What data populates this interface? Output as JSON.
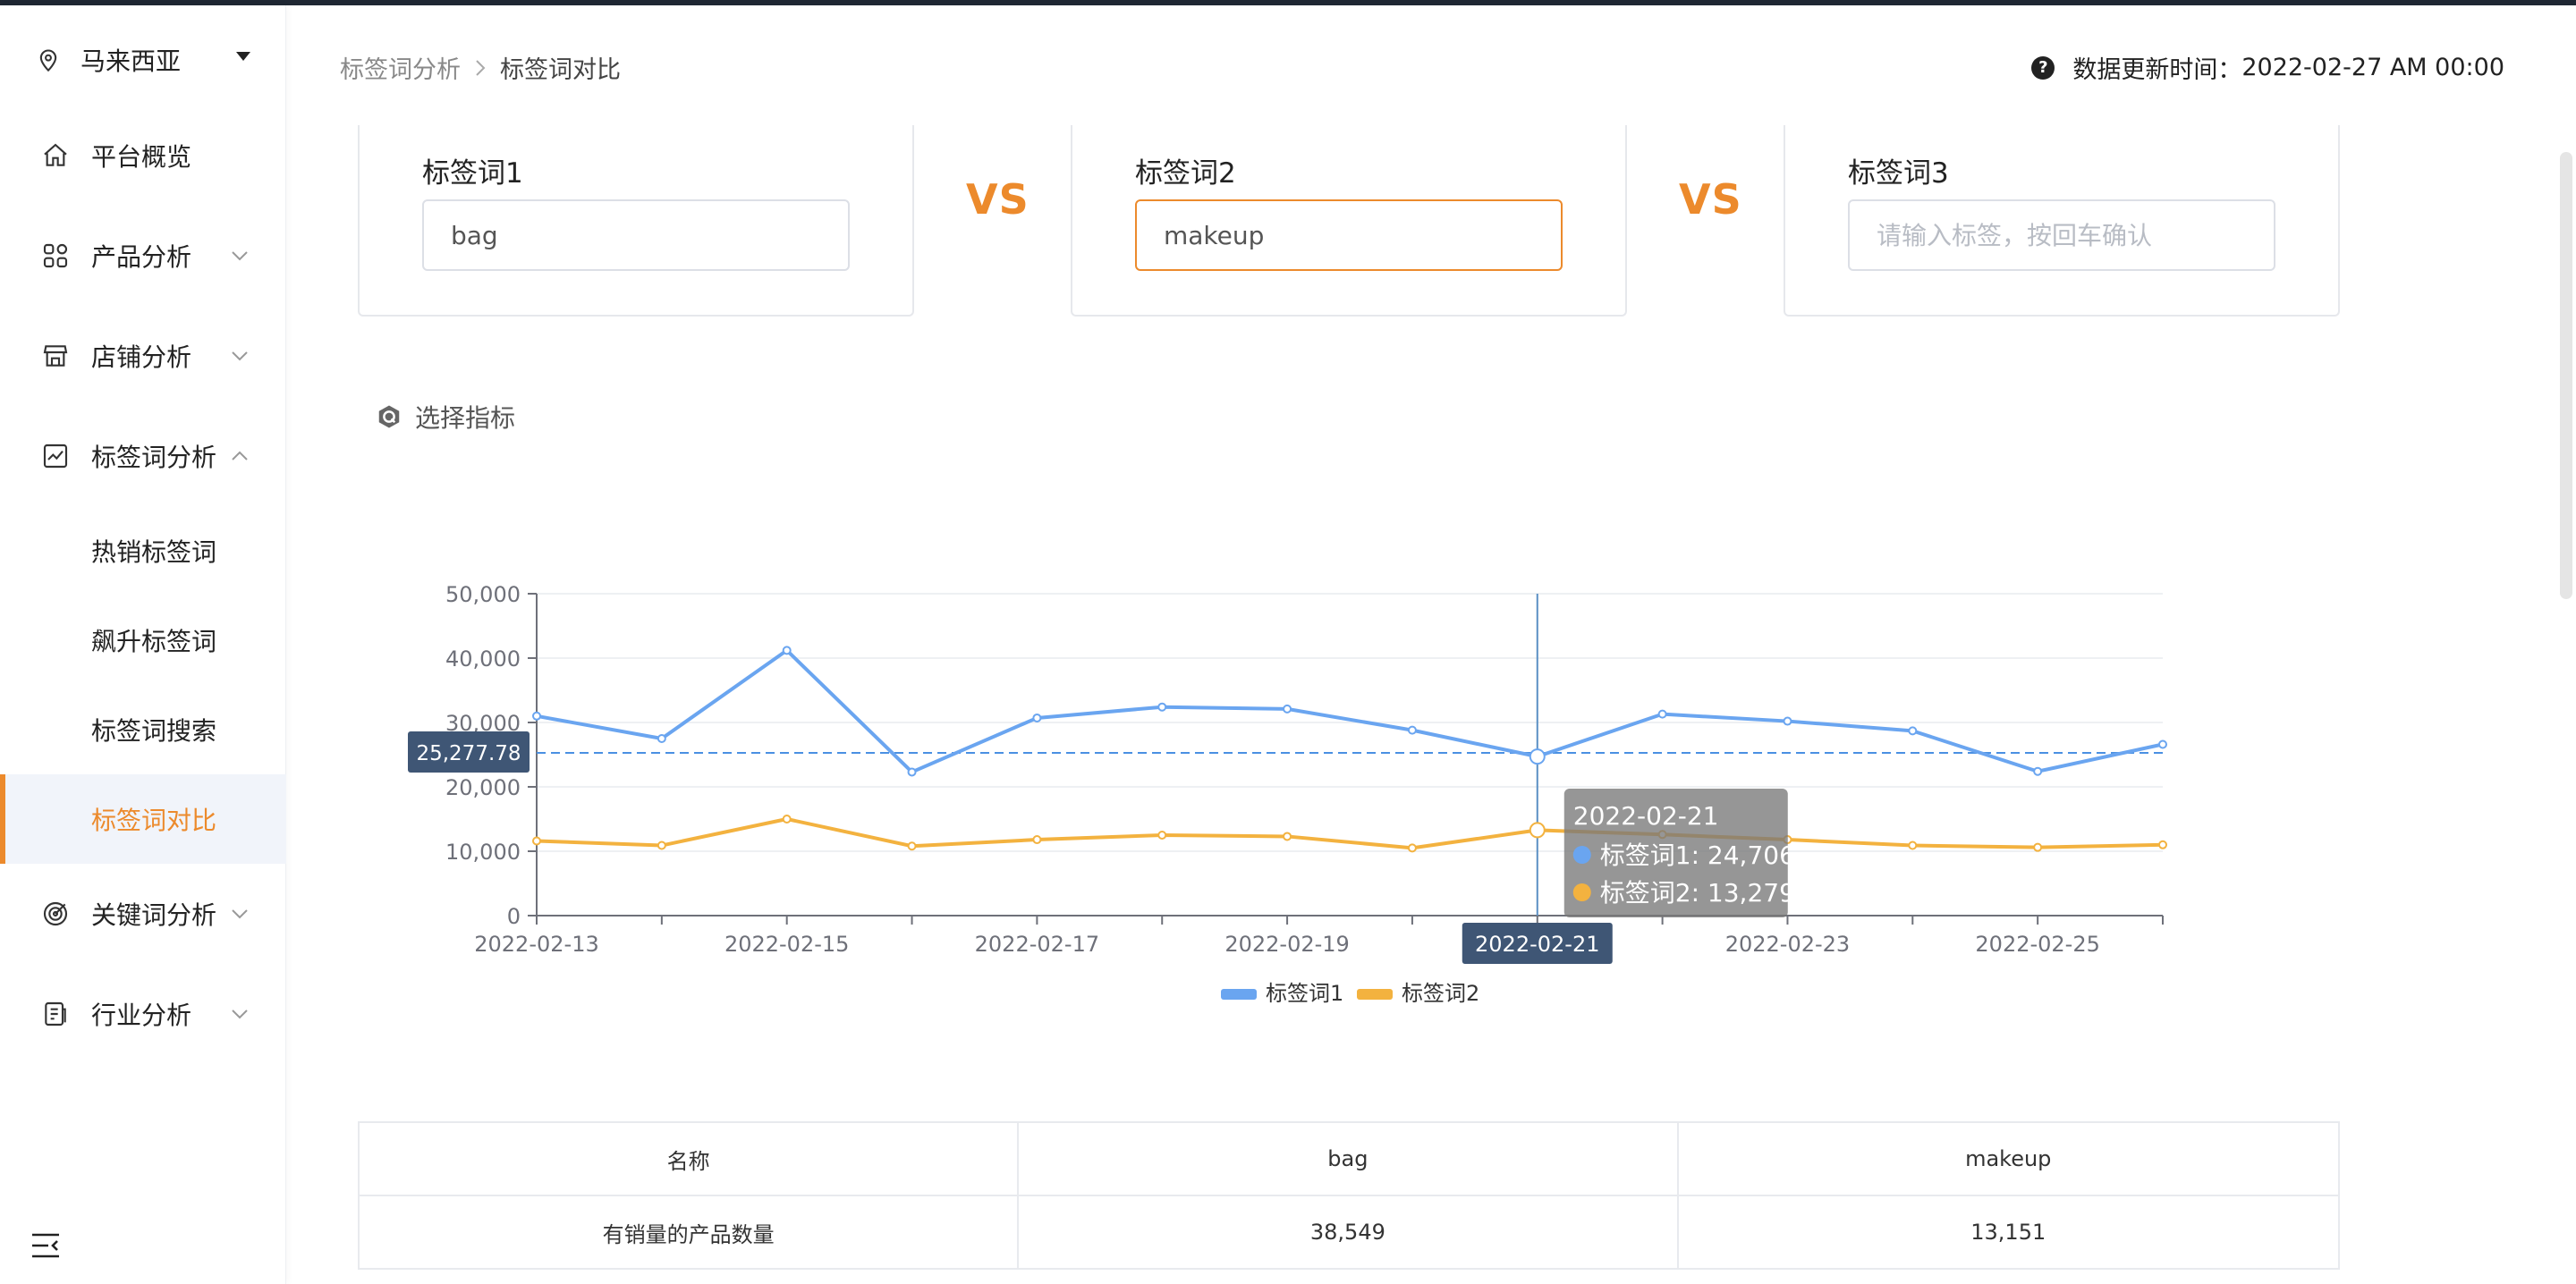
{
  "sidebar": {
    "region": "马来西亚",
    "items": [
      {
        "label": "平台概览"
      },
      {
        "label": "产品分析"
      },
      {
        "label": "店铺分析"
      },
      {
        "label": "标签词分析"
      },
      {
        "label": "热销标签词"
      },
      {
        "label": "飙升标签词"
      },
      {
        "label": "标签词搜索"
      },
      {
        "label": "标签词对比"
      },
      {
        "label": "关键词分析"
      },
      {
        "label": "行业分析"
      }
    ]
  },
  "header": {
    "breadcrumb": [
      "标签词分析",
      "标签词对比"
    ],
    "update_label": "数据更新时间：",
    "update_value": "2022-02-27 AM 00:00"
  },
  "tags": [
    {
      "title": "标签词1",
      "value": "bag",
      "placeholder": ""
    },
    {
      "title": "标签词2",
      "value": "makeup",
      "placeholder": ""
    },
    {
      "title": "标签词3",
      "value": "",
      "placeholder": "请输入标签，按回车确认"
    }
  ],
  "vs_label": "VS",
  "metric_label": "选择指标",
  "chart_data": {
    "type": "line",
    "x": [
      "2022-02-13",
      "2022-02-14",
      "2022-02-15",
      "2022-02-16",
      "2022-02-17",
      "2022-02-18",
      "2022-02-19",
      "2022-02-20",
      "2022-02-21",
      "2022-02-22",
      "2022-02-23",
      "2022-02-24",
      "2022-02-25",
      "2022-02-26"
    ],
    "x_tick_labels": [
      "2022-02-13",
      "2022-02-15",
      "2022-02-17",
      "2022-02-19",
      "2022-02-21",
      "2022-02-23",
      "2022-02-25"
    ],
    "y_tick_labels": [
      "0",
      "10,000",
      "20,000",
      "30,000",
      "40,000",
      "50,000"
    ],
    "ylim": [
      0,
      50000
    ],
    "series": [
      {
        "name": "标签词1",
        "color": "#6aa5f0",
        "values": [
          31000,
          27500,
          41200,
          22300,
          30700,
          32400,
          32100,
          28800,
          24706,
          31300,
          30200,
          28700,
          22400,
          26600
        ]
      },
      {
        "name": "标签词2",
        "color": "#f3b23f",
        "values": [
          11600,
          10900,
          15000,
          10800,
          11800,
          12500,
          12300,
          10500,
          13279,
          12600,
          11800,
          10900,
          10600,
          11000
        ]
      }
    ],
    "average_line": {
      "value": 25277.78,
      "label": "25,277.78"
    },
    "tooltip": {
      "date": "2022-02-21",
      "lines": [
        "标签词1: 24,706",
        "标签词2: 13,279"
      ]
    },
    "crosshair_label": "2022-02-21",
    "legend": [
      "标签词1",
      "标签词2"
    ],
    "grid": true
  },
  "table": {
    "headers": [
      "名称",
      "bag",
      "makeup"
    ],
    "rows": [
      [
        "有销量的产品数量",
        "38,549",
        "13,151"
      ]
    ]
  }
}
